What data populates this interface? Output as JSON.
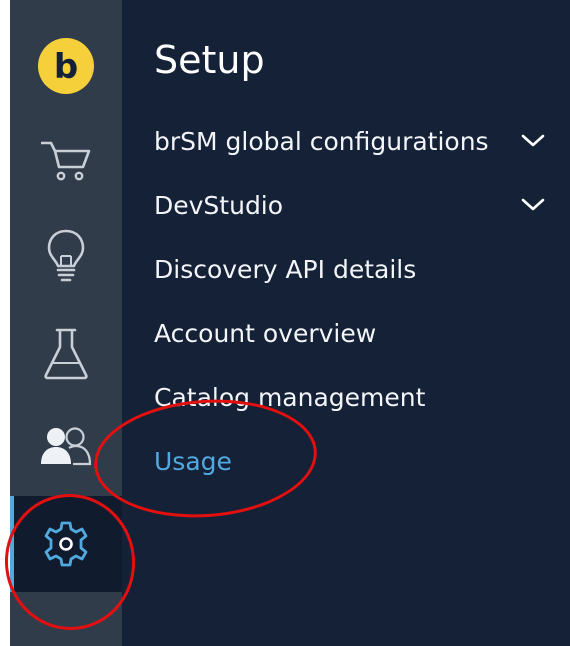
{
  "rail": {
    "items": [
      {
        "icon": "brand-logo-icon",
        "label": "b"
      },
      {
        "icon": "cart-icon"
      },
      {
        "icon": "lightbulb-icon"
      },
      {
        "icon": "flask-icon"
      },
      {
        "icon": "users-icon"
      },
      {
        "icon": "gear-icon",
        "active": true
      }
    ]
  },
  "setup": {
    "title": "Setup",
    "items": [
      {
        "label": "brSM global configurations",
        "expandable": true
      },
      {
        "label": "DevStudio",
        "expandable": true
      },
      {
        "label": "Discovery API details",
        "expandable": false
      },
      {
        "label": "Account overview",
        "expandable": false
      },
      {
        "label": "Catalog management",
        "expandable": false
      },
      {
        "label": "Usage",
        "expandable": false,
        "selected": true
      }
    ]
  },
  "colors": {
    "rail_bg": "#313c4b",
    "panel_bg": "#142136",
    "active_rail_bg": "#101c2d",
    "accent_blue": "#52a9e0",
    "logo_yellow": "#f5d03b",
    "annotation_red": "#e40f0f"
  }
}
